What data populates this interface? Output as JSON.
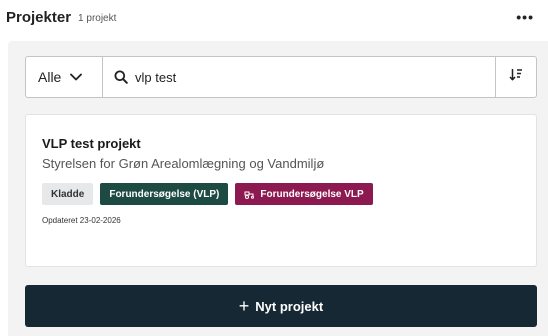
{
  "header": {
    "title": "Projekter",
    "count": "1 projekt",
    "more_icon": "more-horizontal-icon",
    "more_symbol": "•••"
  },
  "filter": {
    "selected": "Alle",
    "icon": "chevron-down-icon"
  },
  "search": {
    "value": "vlp test",
    "icon": "search-icon"
  },
  "sort": {
    "icon": "sort-icon"
  },
  "project": {
    "title": "VLP test projekt",
    "organization": "Styrelsen for Grøn Arealomlægning og Vandmiljø",
    "tags": [
      {
        "label": "Kladde",
        "color": "#e6e8ea"
      },
      {
        "label": "Forundersøgelse (VLP)",
        "color": "#1e4a44"
      },
      {
        "label": "Forundersøgelse VLP",
        "color": "#8c1a50",
        "icon": "tractor-icon"
      }
    ],
    "updated": "Opdateret 23-02-2026"
  },
  "actions": {
    "new_project_label": "Nyt projekt",
    "new_project_icon": "plus-icon",
    "plus_symbol": "+"
  },
  "colors": {
    "panel_bg": "#f3f3f4",
    "primary_button": "#162834",
    "accent_green": "#1e4a44",
    "accent_pink": "#8c1a50"
  }
}
